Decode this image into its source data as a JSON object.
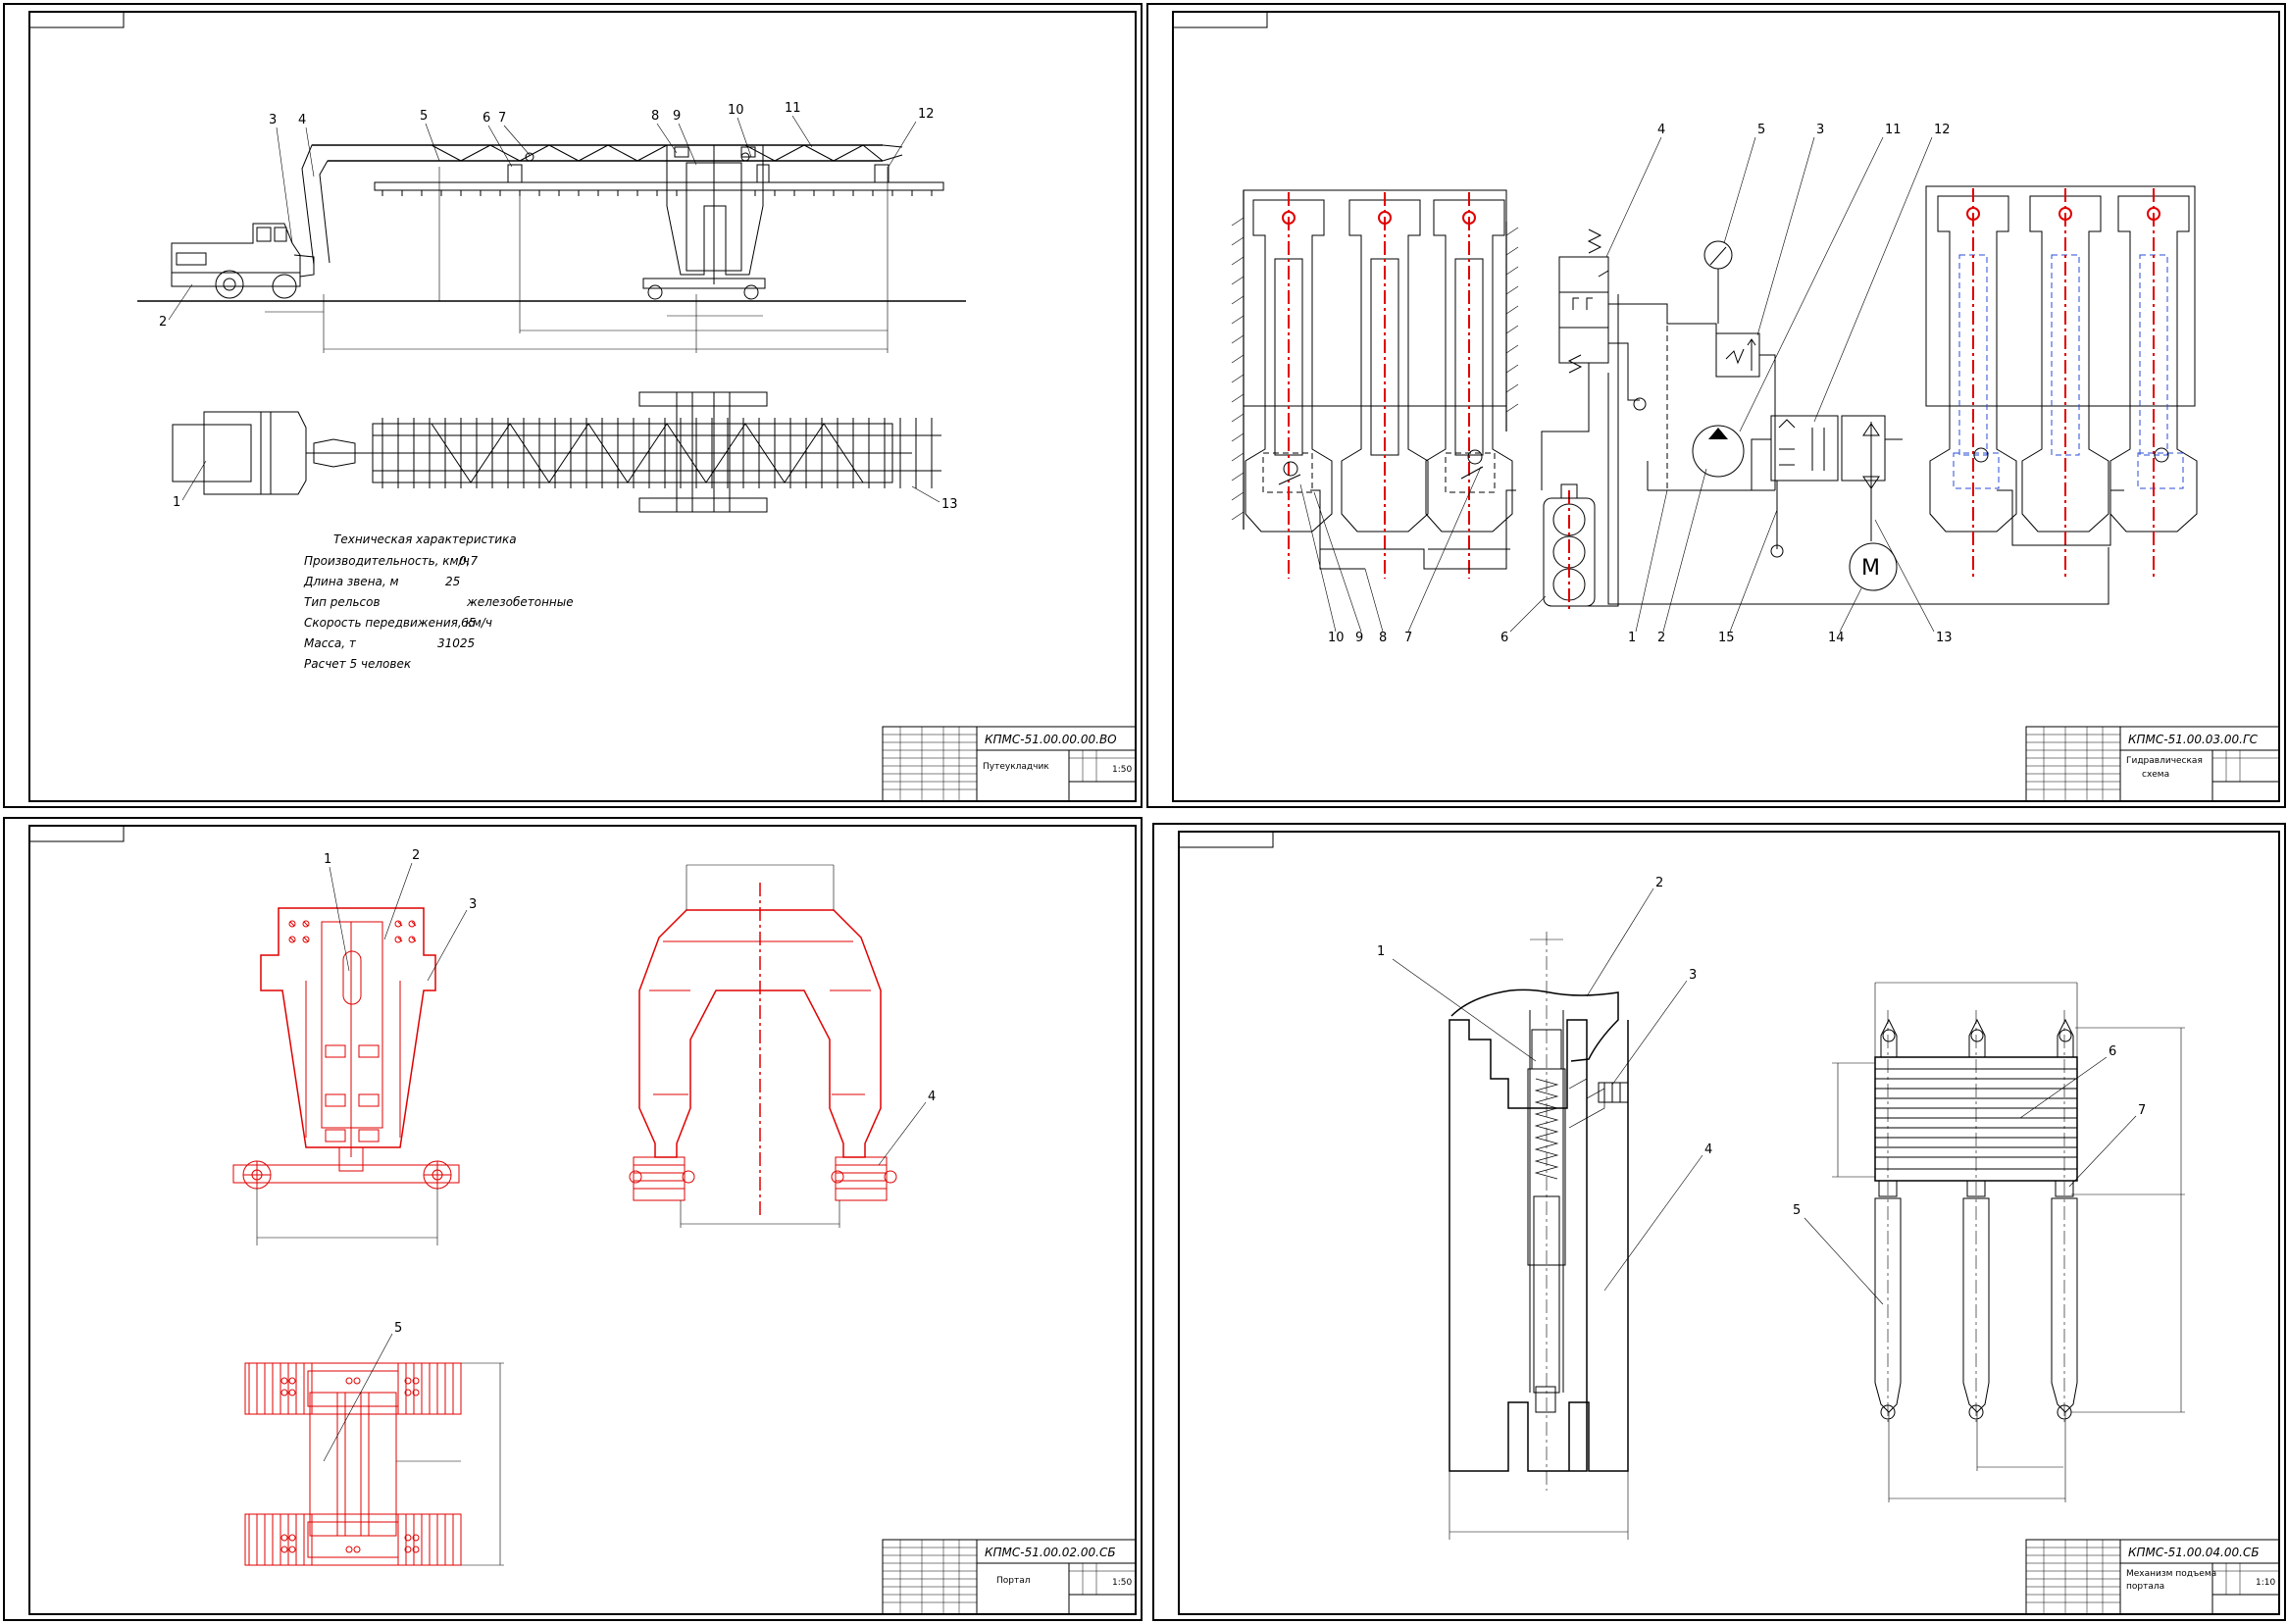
{
  "sheets": [
    {
      "id": "general-view",
      "code": "КПМС-51.00.00.00.ВО",
      "title": "Путеукладчик",
      "subtitle": "",
      "scale": "1:50",
      "callouts": [
        "1",
        "2",
        "3",
        "4",
        "5",
        "6",
        "7",
        "8",
        "9",
        "10",
        "11",
        "12",
        "13"
      ],
      "spec_title": "Техническая характеристика",
      "spec_rows": [
        {
          "label": "Производительность, км/ч",
          "value": "0,7"
        },
        {
          "label": "Длина звена, м",
          "value": "25"
        },
        {
          "label": "Тип рельсов",
          "value": "железобетонные"
        },
        {
          "label": "Скорость передвижения, км/ч",
          "value": "65"
        },
        {
          "label": "Масса, т",
          "value": "31025"
        },
        {
          "label": "Расчет 5 человек",
          "value": ""
        }
      ]
    },
    {
      "id": "hydraulic-scheme",
      "code": "КПМС-51.00.03.00.ГС",
      "title": "Гидравлическая",
      "subtitle": "схема",
      "scale": "",
      "motor_label": "М",
      "callouts": [
        "1",
        "2",
        "3",
        "4",
        "5",
        "6",
        "7",
        "8",
        "9",
        "10",
        "11",
        "12",
        "13",
        "14",
        "15"
      ]
    },
    {
      "id": "portal",
      "code": "КПМС-51.00.02.00.СБ",
      "title": "Портал",
      "subtitle": "",
      "scale": "1:50",
      "callouts": [
        "1",
        "2",
        "3",
        "4",
        "5"
      ]
    },
    {
      "id": "lifting-mechanism",
      "code": "КПМС-51.00.04.00.СБ",
      "title": "Механизм подъема",
      "subtitle": "портала",
      "scale": "1:10",
      "callouts": [
        "1",
        "2",
        "3",
        "4",
        "5",
        "6",
        "7"
      ]
    }
  ],
  "colors": {
    "ink": "#000000",
    "highlight": "#e00000",
    "hidden": "#2a4bd7"
  }
}
